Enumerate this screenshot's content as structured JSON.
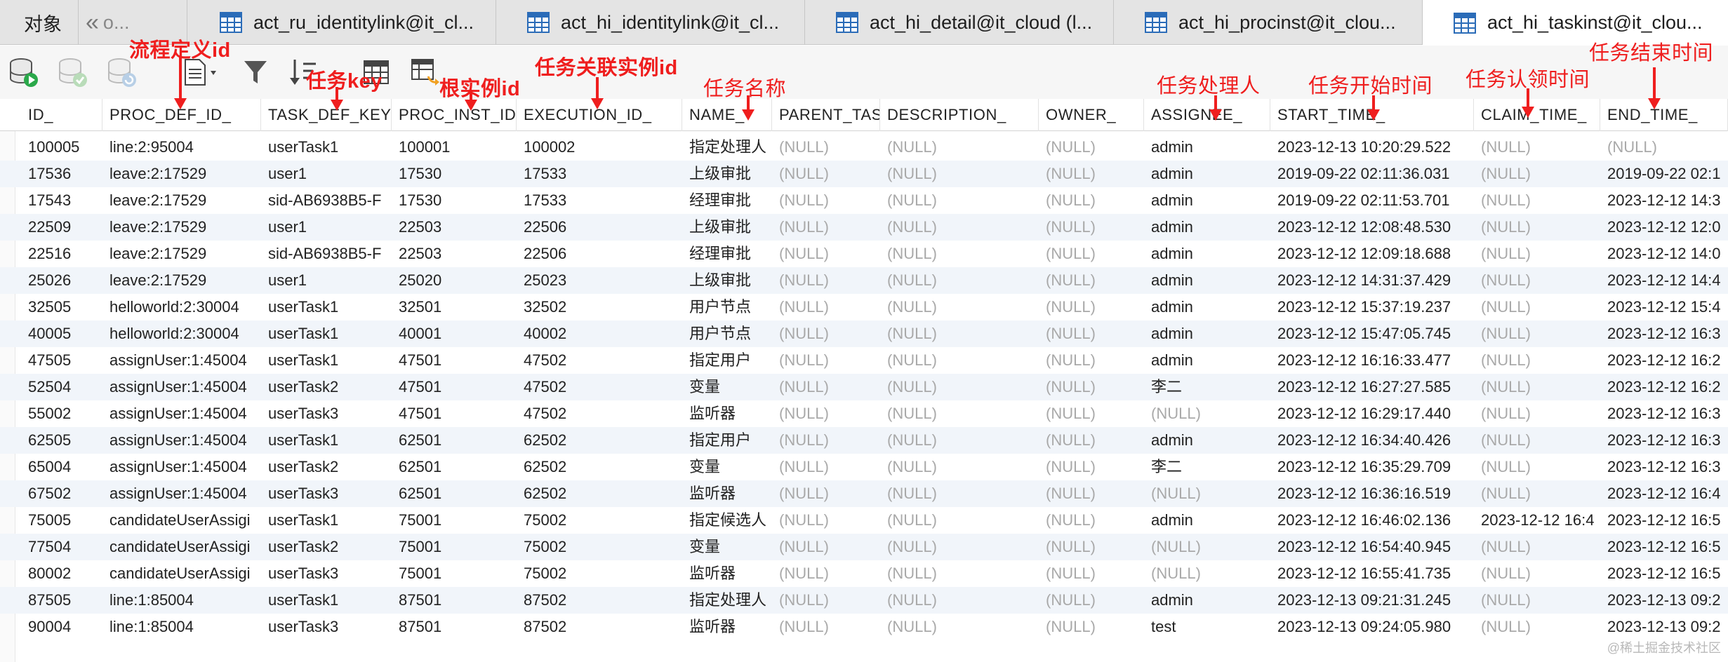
{
  "tabs": [
    {
      "label": "对象"
    },
    {
      "label": "o..."
    },
    {
      "label": "act_ru_identitylink@it_cl..."
    },
    {
      "label": "act_hi_identitylink@it_cl..."
    },
    {
      "label": "act_hi_detail@it_cloud (l..."
    },
    {
      "label": "act_hi_procinst@it_clou..."
    },
    {
      "label": "act_hi_taskinst@it_clou..."
    }
  ],
  "grid": {
    "columns": [
      "ID_",
      "PROC_DEF_ID_",
      "TASK_DEF_KEY",
      "PROC_INST_ID",
      "EXECUTION_ID_",
      "NAME_",
      "PARENT_TAS",
      "DESCRIPTION_",
      "OWNER_",
      "ASSIGNEE_",
      "START_TIME_",
      "CLAIM_TIME_",
      "END_TIME_"
    ],
    "rows": [
      [
        "100005",
        "line:2:95004",
        "userTask1",
        "100001",
        "100002",
        "指定处理人",
        "(NULL)",
        "(NULL)",
        "(NULL)",
        "admin",
        "2023-12-13 10:20:29.522",
        "(NULL)",
        "(NULL)"
      ],
      [
        "17536",
        "leave:2:17529",
        "user1",
        "17530",
        "17533",
        "上级审批",
        "(NULL)",
        "(NULL)",
        "(NULL)",
        "admin",
        "2019-09-22 02:11:36.031",
        "(NULL)",
        "2019-09-22 02:1"
      ],
      [
        "17543",
        "leave:2:17529",
        "sid-AB6938B5-F",
        "17530",
        "17533",
        "经理审批",
        "(NULL)",
        "(NULL)",
        "(NULL)",
        "admin",
        "2019-09-22 02:11:53.701",
        "(NULL)",
        "2023-12-12 14:3"
      ],
      [
        "22509",
        "leave:2:17529",
        "user1",
        "22503",
        "22506",
        "上级审批",
        "(NULL)",
        "(NULL)",
        "(NULL)",
        "admin",
        "2023-12-12 12:08:48.530",
        "(NULL)",
        "2023-12-12 12:0"
      ],
      [
        "22516",
        "leave:2:17529",
        "sid-AB6938B5-F",
        "22503",
        "22506",
        "经理审批",
        "(NULL)",
        "(NULL)",
        "(NULL)",
        "admin",
        "2023-12-12 12:09:18.688",
        "(NULL)",
        "2023-12-12 14:0"
      ],
      [
        "25026",
        "leave:2:17529",
        "user1",
        "25020",
        "25023",
        "上级审批",
        "(NULL)",
        "(NULL)",
        "(NULL)",
        "admin",
        "2023-12-12 14:31:37.429",
        "(NULL)",
        "2023-12-12 14:4"
      ],
      [
        "32505",
        "helloworld:2:30004",
        "userTask1",
        "32501",
        "32502",
        "用户节点",
        "(NULL)",
        "(NULL)",
        "(NULL)",
        "admin",
        "2023-12-12 15:37:19.237",
        "(NULL)",
        "2023-12-12 15:4"
      ],
      [
        "40005",
        "helloworld:2:30004",
        "userTask1",
        "40001",
        "40002",
        "用户节点",
        "(NULL)",
        "(NULL)",
        "(NULL)",
        "admin",
        "2023-12-12 15:47:05.745",
        "(NULL)",
        "2023-12-12 16:3"
      ],
      [
        "47505",
        "assignUser:1:45004",
        "userTask1",
        "47501",
        "47502",
        "指定用户",
        "(NULL)",
        "(NULL)",
        "(NULL)",
        "admin",
        "2023-12-12 16:16:33.477",
        "(NULL)",
        "2023-12-12 16:2"
      ],
      [
        "52504",
        "assignUser:1:45004",
        "userTask2",
        "47501",
        "47502",
        "变量",
        "(NULL)",
        "(NULL)",
        "(NULL)",
        "李二",
        "2023-12-12 16:27:27.585",
        "(NULL)",
        "2023-12-12 16:2"
      ],
      [
        "55002",
        "assignUser:1:45004",
        "userTask3",
        "47501",
        "47502",
        "监听器",
        "(NULL)",
        "(NULL)",
        "(NULL)",
        "(NULL)",
        "2023-12-12 16:29:17.440",
        "(NULL)",
        "2023-12-12 16:3"
      ],
      [
        "62505",
        "assignUser:1:45004",
        "userTask1",
        "62501",
        "62502",
        "指定用户",
        "(NULL)",
        "(NULL)",
        "(NULL)",
        "admin",
        "2023-12-12 16:34:40.426",
        "(NULL)",
        "2023-12-12 16:3"
      ],
      [
        "65004",
        "assignUser:1:45004",
        "userTask2",
        "62501",
        "62502",
        "变量",
        "(NULL)",
        "(NULL)",
        "(NULL)",
        "李二",
        "2023-12-12 16:35:29.709",
        "(NULL)",
        "2023-12-12 16:3"
      ],
      [
        "67502",
        "assignUser:1:45004",
        "userTask3",
        "62501",
        "62502",
        "监听器",
        "(NULL)",
        "(NULL)",
        "(NULL)",
        "(NULL)",
        "2023-12-12 16:36:16.519",
        "(NULL)",
        "2023-12-12 16:4"
      ],
      [
        "75005",
        "candidateUserAssigi",
        "userTask1",
        "75001",
        "75002",
        "指定候选人",
        "(NULL)",
        "(NULL)",
        "(NULL)",
        "admin",
        "2023-12-12 16:46:02.136",
        "2023-12-12 16:4",
        "2023-12-12 16:5"
      ],
      [
        "77504",
        "candidateUserAssigi",
        "userTask2",
        "75001",
        "75002",
        "变量",
        "(NULL)",
        "(NULL)",
        "(NULL)",
        "(NULL)",
        "2023-12-12 16:54:40.945",
        "(NULL)",
        "2023-12-12 16:5"
      ],
      [
        "80002",
        "candidateUserAssigi",
        "userTask3",
        "75001",
        "75002",
        "监听器",
        "(NULL)",
        "(NULL)",
        "(NULL)",
        "(NULL)",
        "2023-12-12 16:55:41.735",
        "(NULL)",
        "2023-12-12 16:5"
      ],
      [
        "87505",
        "line:1:85004",
        "userTask1",
        "87501",
        "87502",
        "指定处理人",
        "(NULL)",
        "(NULL)",
        "(NULL)",
        "admin",
        "2023-12-13 09:21:31.245",
        "(NULL)",
        "2023-12-13 09:2"
      ],
      [
        "90004",
        "line:1:85004",
        "userTask3",
        "87501",
        "87502",
        "监听器",
        "(NULL)",
        "(NULL)",
        "(NULL)",
        "test",
        "2023-12-13 09:24:05.980",
        "(NULL)",
        "2023-12-13 09:2"
      ]
    ]
  },
  "annotations": {
    "proc_def_id": "流程定义id",
    "task_key": "任务key",
    "root_instance_id": "根实例id",
    "task_instance_id": "任务关联实例id",
    "task_name": "任务名称",
    "assignee": "任务处理人",
    "start_time": "任务开始时间",
    "claim_time": "任务认领时间",
    "end_time": "任务结束时间"
  },
  "watermark": "@稀土掘金技术社区",
  "colors": {
    "annotation": "#ef1e1e",
    "null_text": "#a9a9a9",
    "row_alt": "#f1f5fa",
    "table_icon": "#2b6cb8"
  },
  "icons": {
    "toolbar": [
      "db-start-icon",
      "db-commit-icon",
      "db-refresh-icon",
      "document-icon",
      "filter-icon",
      "sort-icon",
      "grid-icon",
      "export-icon"
    ],
    "tabs": "table-icon"
  }
}
